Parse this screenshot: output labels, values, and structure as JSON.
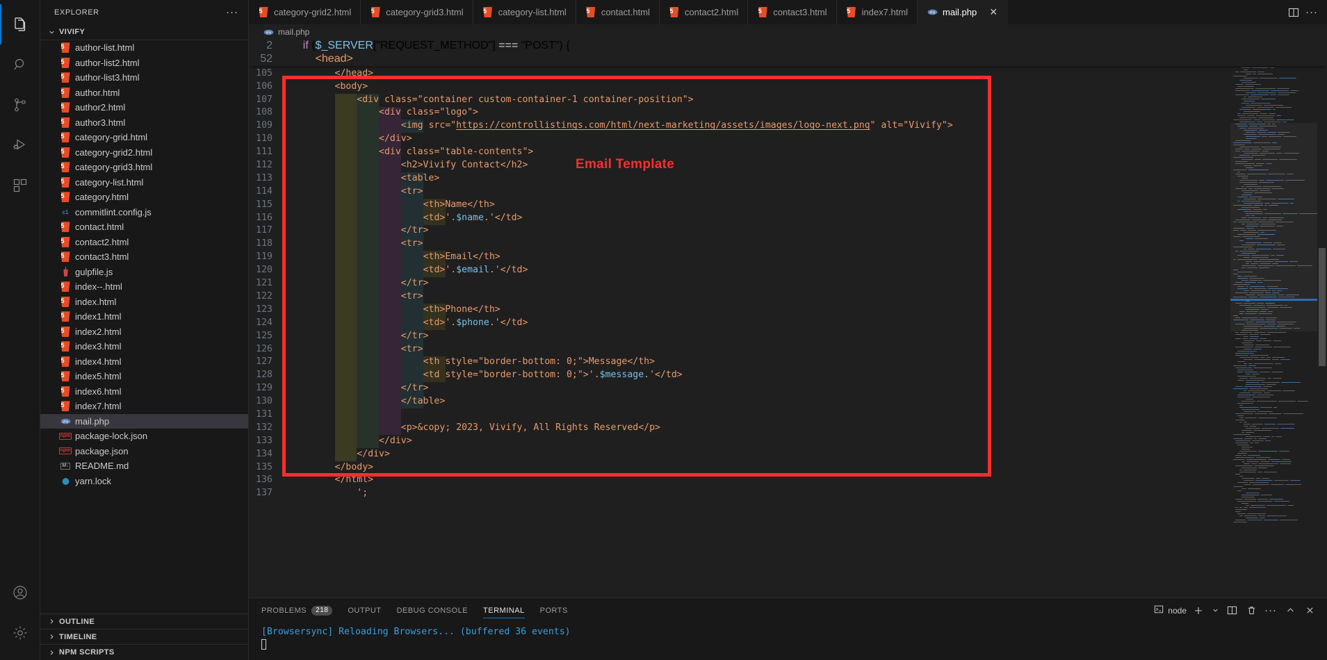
{
  "activitybar": {
    "items": [
      {
        "name": "explorer",
        "icon": "files-icon",
        "active": true
      },
      {
        "name": "search",
        "icon": "search-icon",
        "active": false
      },
      {
        "name": "source-control",
        "icon": "source-control-icon",
        "active": false
      },
      {
        "name": "run-and-debug",
        "icon": "run-debug-icon",
        "active": false
      },
      {
        "name": "extensions",
        "icon": "extensions-icon",
        "active": false
      }
    ],
    "bottom": [
      {
        "name": "accounts",
        "icon": "account-icon"
      },
      {
        "name": "settings",
        "icon": "gear-icon"
      }
    ]
  },
  "sidebar": {
    "title": "EXPLORER",
    "more_label": "···",
    "project": "VIVIFY",
    "files": [
      {
        "label": "author-list.html",
        "icon": "html5-icon"
      },
      {
        "label": "author-list2.html",
        "icon": "html5-icon"
      },
      {
        "label": "author-list3.html",
        "icon": "html5-icon"
      },
      {
        "label": "author.html",
        "icon": "html5-icon"
      },
      {
        "label": "author2.html",
        "icon": "html5-icon"
      },
      {
        "label": "author3.html",
        "icon": "html5-icon"
      },
      {
        "label": "category-grid.html",
        "icon": "html5-icon"
      },
      {
        "label": "category-grid2.html",
        "icon": "html5-icon"
      },
      {
        "label": "category-grid3.html",
        "icon": "html5-icon"
      },
      {
        "label": "category-list.html",
        "icon": "html5-icon"
      },
      {
        "label": "category.html",
        "icon": "html5-icon"
      },
      {
        "label": "commitlint.config.js",
        "icon": "commitlint-icon"
      },
      {
        "label": "contact.html",
        "icon": "html5-icon"
      },
      {
        "label": "contact2.html",
        "icon": "html5-icon"
      },
      {
        "label": "contact3.html",
        "icon": "html5-icon"
      },
      {
        "label": "gulpfile.js",
        "icon": "gulp-icon"
      },
      {
        "label": "index--.html",
        "icon": "html5-icon"
      },
      {
        "label": "index.html",
        "icon": "html5-icon"
      },
      {
        "label": "index1.html",
        "icon": "html5-icon"
      },
      {
        "label": "index2.html",
        "icon": "html5-icon"
      },
      {
        "label": "index3.html",
        "icon": "html5-icon"
      },
      {
        "label": "index4.html",
        "icon": "html5-icon"
      },
      {
        "label": "index5.html",
        "icon": "html5-icon"
      },
      {
        "label": "index6.html",
        "icon": "html5-icon"
      },
      {
        "label": "index7.html",
        "icon": "html5-icon"
      },
      {
        "label": "mail.php",
        "icon": "php-icon",
        "selected": true
      },
      {
        "label": "package-lock.json",
        "icon": "npm-icon"
      },
      {
        "label": "package.json",
        "icon": "npm-icon"
      },
      {
        "label": "README.md",
        "icon": "markdown-icon"
      },
      {
        "label": "yarn.lock",
        "icon": "yarn-icon"
      }
    ],
    "panels": [
      "OUTLINE",
      "TIMELINE",
      "NPM SCRIPTS"
    ]
  },
  "tabs": [
    {
      "label": "category-grid2.html",
      "icon": "html5-icon",
      "active": false
    },
    {
      "label": "category-grid3.html",
      "icon": "html5-icon",
      "active": false
    },
    {
      "label": "category-list.html",
      "icon": "html5-icon",
      "active": false
    },
    {
      "label": "contact.html",
      "icon": "html5-icon",
      "active": false
    },
    {
      "label": "contact2.html",
      "icon": "html5-icon",
      "active": false
    },
    {
      "label": "contact3.html",
      "icon": "html5-icon",
      "active": false
    },
    {
      "label": "index7.html",
      "icon": "html5-icon",
      "active": false
    },
    {
      "label": "mail.php",
      "icon": "php-icon",
      "active": true,
      "close": "✕"
    }
  ],
  "tabbar_actions": [
    {
      "name": "split-editor-icon",
      "glyph": "split"
    },
    {
      "name": "more-actions-icon",
      "glyph": "···"
    }
  ],
  "breadcrumb": {
    "file": "mail.php",
    "icon": "php-icon"
  },
  "editor": {
    "sticky_lines": [
      {
        "num": "2",
        "indent": 1,
        "text": "if ($_SERVER[\"REQUEST_METHOD\"] === \"POST\") {"
      },
      {
        "num": "52",
        "indent": 2,
        "text": "<head>"
      }
    ],
    "lines": [
      {
        "num": "105",
        "text": "</head>"
      },
      {
        "num": "106",
        "text": "<body>"
      },
      {
        "num": "107",
        "text": "<div class=\"container custom-container-1 container-position\">"
      },
      {
        "num": "108",
        "text": "<div class=\"logo\">"
      },
      {
        "num": "109",
        "text": "<img src=\"https://controllistings.com/html/next-marketing/assets/images/logo-next.png\" alt=\"Vivify\">"
      },
      {
        "num": "110",
        "text": "</div>"
      },
      {
        "num": "111",
        "text": "<div class=\"table-contents\">"
      },
      {
        "num": "112",
        "text": "<h2>Vivify Contact</h2>"
      },
      {
        "num": "113",
        "text": "<table>"
      },
      {
        "num": "114",
        "text": "<tr>"
      },
      {
        "num": "115",
        "text": "<th>Name</th>"
      },
      {
        "num": "116",
        "text": "<td>'.$name.'</td>"
      },
      {
        "num": "117",
        "text": "</tr>"
      },
      {
        "num": "118",
        "text": "<tr>"
      },
      {
        "num": "119",
        "text": "<th>Email</th>"
      },
      {
        "num": "120",
        "text": "<td>'.$email.'</td>"
      },
      {
        "num": "121",
        "text": "</tr>"
      },
      {
        "num": "122",
        "text": "<tr>"
      },
      {
        "num": "123",
        "text": "<th>Phone</th>"
      },
      {
        "num": "124",
        "text": "<td>'.$phone.'</td>"
      },
      {
        "num": "125",
        "text": "</tr>"
      },
      {
        "num": "126",
        "text": "<tr>"
      },
      {
        "num": "127",
        "text": "<th style=\"border-bottom: 0;\">Message</th>"
      },
      {
        "num": "128",
        "text": "<td style=\"border-bottom: 0;\">'.$message.'</td>"
      },
      {
        "num": "129",
        "text": "</tr>"
      },
      {
        "num": "130",
        "text": "</table>"
      },
      {
        "num": "131",
        "text": ""
      },
      {
        "num": "132",
        "text": "<p>&copy; 2023, Vivify, All Rights Reserved</p>"
      },
      {
        "num": "133",
        "text": "</div>"
      },
      {
        "num": "134",
        "text": "</div>"
      },
      {
        "num": "135",
        "text": "</body>"
      },
      {
        "num": "136",
        "text": "</html>"
      },
      {
        "num": "137",
        "text": "';"
      }
    ],
    "annotation": {
      "label": "Email Template",
      "color": "#ff2d2d"
    }
  },
  "panel": {
    "tabs": [
      {
        "label": "PROBLEMS",
        "badge": "218",
        "active": false
      },
      {
        "label": "OUTPUT",
        "badge": "",
        "active": false
      },
      {
        "label": "DEBUG CONSOLE",
        "badge": "",
        "active": false
      },
      {
        "label": "TERMINAL",
        "badge": "",
        "active": true
      },
      {
        "label": "PORTS",
        "badge": "",
        "active": false
      }
    ],
    "shell": {
      "label": "node",
      "icon": "terminal-icon"
    },
    "actions": [
      {
        "name": "new-terminal-icon",
        "glyph": "+"
      },
      {
        "name": "chevron-down-icon",
        "glyph": "⌄"
      },
      {
        "name": "split-terminal-icon",
        "glyph": "split"
      },
      {
        "name": "kill-terminal-icon",
        "glyph": "trash"
      },
      {
        "name": "more-actions-icon",
        "glyph": "···"
      },
      {
        "name": "maximize-panel-icon",
        "glyph": "∧"
      },
      {
        "name": "close-panel-icon",
        "glyph": "✕"
      }
    ],
    "terminal_output": "[Browsersync] Reloading Browsers... (buffered 36 events)"
  },
  "colors": {
    "accent": "#0078d4",
    "annotation": "#ff0000",
    "tag": "#e89b6c",
    "variable": "#79c0e8",
    "terminal_text": "#3b9ddd",
    "html_icon": "#e44d26"
  }
}
